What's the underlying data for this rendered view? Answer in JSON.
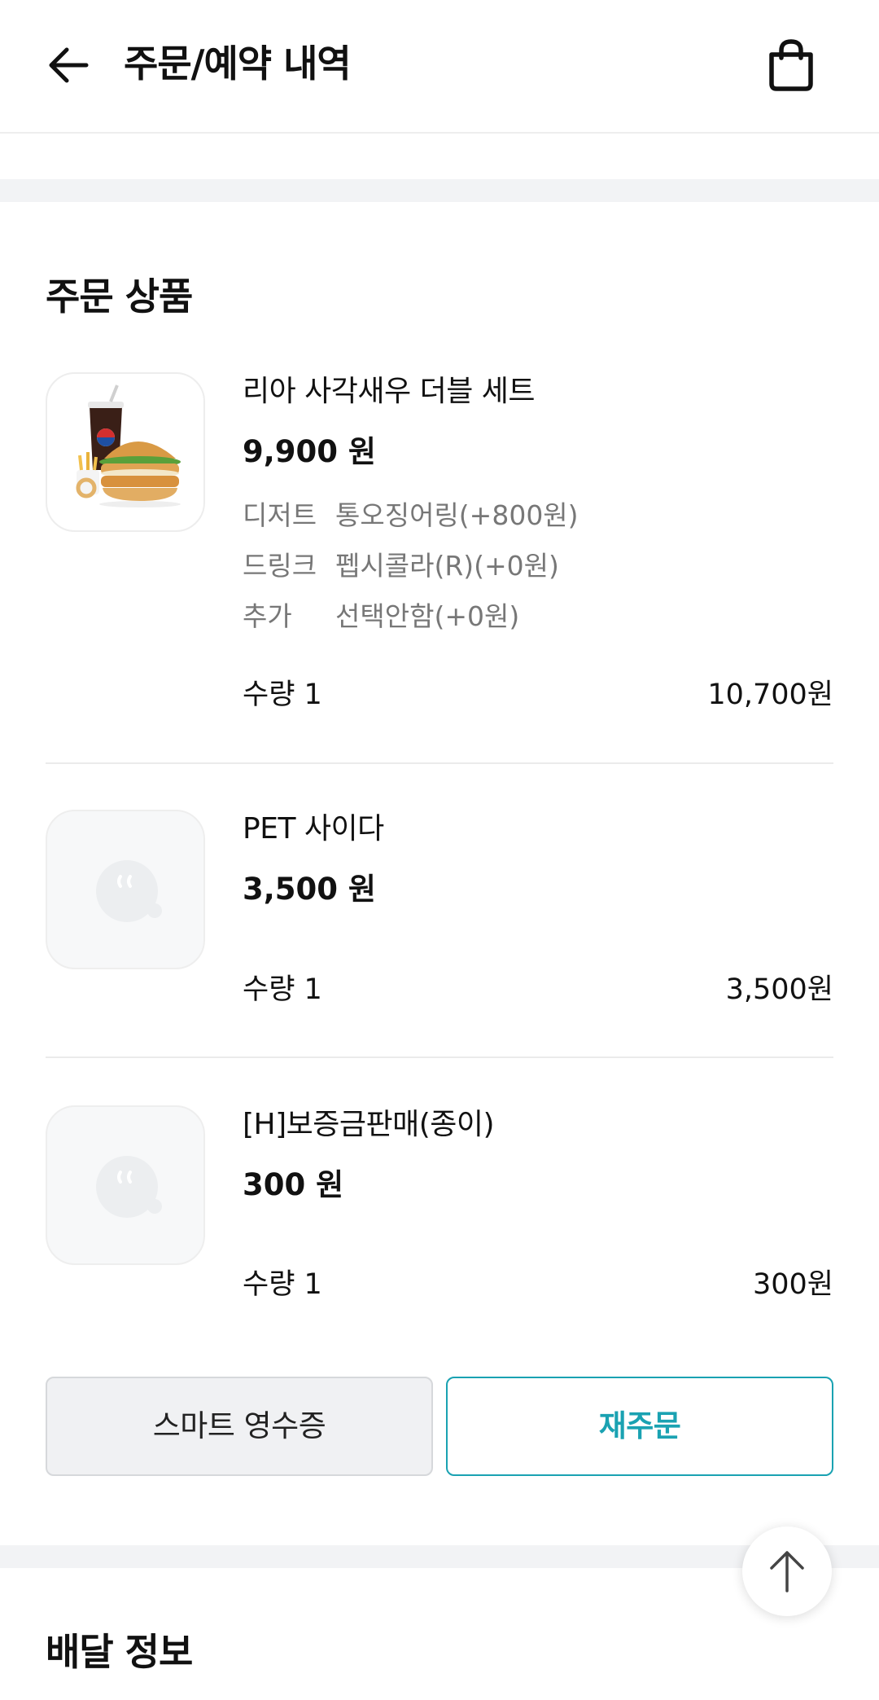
{
  "header": {
    "title": "주문/예약 내역",
    "back_icon": "arrow-left-icon",
    "bag_icon": "shopping-bag-icon"
  },
  "order_section": {
    "title": "주문 상품",
    "items": [
      {
        "name": "리아 사각새우 더블 세트",
        "price": "9,900 원",
        "image": "burger-set-image",
        "options": [
          {
            "label": "디저트",
            "value": "통오징어링(+800원)"
          },
          {
            "label": "드링크",
            "value": "펩시콜라(R)(+0원)"
          },
          {
            "label": "추가",
            "value": "선택안함(+0원)"
          }
        ],
        "quantity": "수량 1",
        "total": "10,700원"
      },
      {
        "name": "PET 사이다",
        "price": "3,500 원",
        "image": "placeholder-image",
        "quantity": "수량 1",
        "total": "3,500원"
      },
      {
        "name": "[H]보증금판매(종이)",
        "price": "300 원",
        "image": "placeholder-image",
        "quantity": "수량 1",
        "total": "300원"
      }
    ],
    "receipt_button": "스마트 영수증",
    "reorder_button": "재주문"
  },
  "delivery_section": {
    "title": "배달 정보"
  },
  "scroll_top_icon": "arrow-up-icon",
  "colors": {
    "accent": "#1aa2b2",
    "band": "#f2f3f5",
    "muted_text": "#777777"
  }
}
